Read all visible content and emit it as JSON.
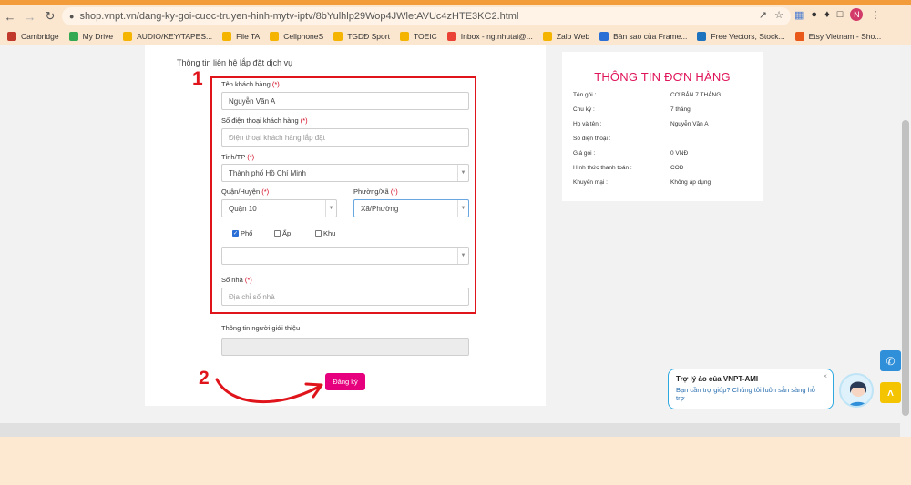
{
  "browser": {
    "url": "shop.vnpt.vn/dang-ky-goi-cuoc-truyen-hinh-mytv-iptv/8bYulhlp29Wop4JWletAVUc4zHTE3KC2.html",
    "profile_initial": "N",
    "bookmarks": [
      {
        "label": "Cambridge",
        "color": "#c0392b"
      },
      {
        "label": "My Drive",
        "color": "#34a853"
      },
      {
        "label": "AUDIO/KEY/TAPES...",
        "color": "#f4b400"
      },
      {
        "label": "File TA",
        "color": "#f4b400"
      },
      {
        "label": "CellphoneS",
        "color": "#f4b400"
      },
      {
        "label": "TGDĐ Sport",
        "color": "#f4b400"
      },
      {
        "label": "TOEIC",
        "color": "#f4b400"
      },
      {
        "label": "Inbox - ng.nhutai@...",
        "color": "#ea4335"
      },
      {
        "label": "Zalo Web",
        "color": "#f4b400"
      },
      {
        "label": "Bản sao của Frame...",
        "color": "#2a6fd6"
      },
      {
        "label": "Free Vectors, Stock...",
        "color": "#1e73be"
      },
      {
        "label": "Etsy Vietnam - Sho...",
        "color": "#e8591a"
      }
    ]
  },
  "form": {
    "section_title": "Thông tin liên hệ lắp đặt dịch vụ",
    "required_mark": "(*)",
    "name_label": "Tên khách hàng",
    "name_value": "Nguyễn Văn A",
    "phone_label": "Số điện thoại khách hàng",
    "phone_placeholder": "Điện thoại khách hàng lắp đặt",
    "province_label": "Tỉnh/TP",
    "province_value": "Thành phố Hồ Chí Minh",
    "district_label": "Quận/Huyện",
    "district_value": "Quận 10",
    "ward_label": "Phường/Xã",
    "ward_value": "Xã/Phường",
    "street_types": [
      {
        "label": "Phố",
        "checked": true
      },
      {
        "label": "Ấp",
        "checked": false
      },
      {
        "label": "Khu",
        "checked": false
      }
    ],
    "street_value": "",
    "house_label": "Số nhà",
    "house_placeholder": "Địa chỉ số nhà",
    "referrer_label": "Thông tin người giới thiệu",
    "submit_label": "Đăng ký"
  },
  "annotations": {
    "step1": "1",
    "step2": "2",
    "color": "#e0141b"
  },
  "order": {
    "title": "THÔNG TIN ĐƠN HÀNG",
    "rows": [
      {
        "label": "Tên gói :",
        "value": "CƠ BẢN 7 THÁNG"
      },
      {
        "label": "Chu kỳ :",
        "value": "7 tháng"
      },
      {
        "label": "Họ và tên :",
        "value": "Nguyễn Văn A"
      },
      {
        "label": "Số điện thoại :",
        "value": ""
      },
      {
        "label": "Giá gói :",
        "value": "0 VNĐ"
      },
      {
        "label": "Hình thức thanh toán :",
        "value": "COD"
      },
      {
        "label": "Khuyến mại :",
        "value": "Không áp dụng"
      }
    ]
  },
  "assistant": {
    "title": "Trợ lý ảo của VNPT-AMI",
    "message": "Bạn cần trợ giúp? Chúng tôi luôn sẵn sàng hỗ trợ",
    "close": "×"
  },
  "colors": {
    "brand_pink": "#e6007e",
    "order_title": "#e0145a",
    "phone_fab": "#2f8fd8",
    "top_fab": "#f5c400"
  }
}
